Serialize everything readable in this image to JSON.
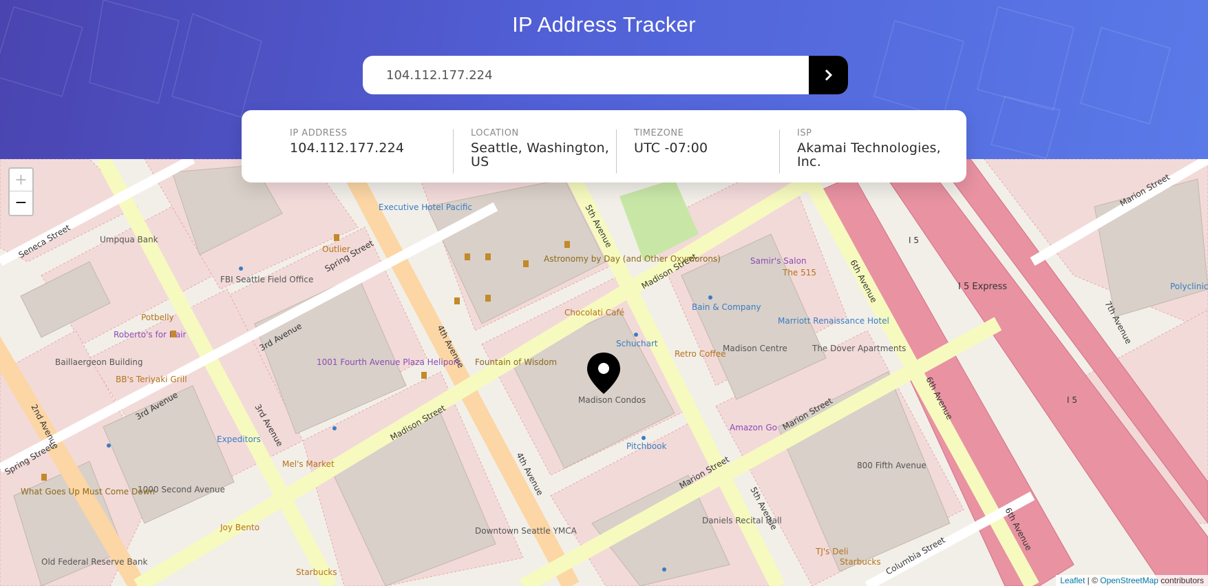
{
  "header": {
    "title": "IP Address Tracker"
  },
  "search": {
    "value": "104.112.177.224",
    "button_icon": "chevron-right-icon"
  },
  "info": {
    "ip_label": "IP ADDRESS",
    "ip_value": "104.112.177.224",
    "location_label": "LOCATION",
    "location_value": "Seattle, Washington, US",
    "timezone_label": "TIMEZONE",
    "timezone_value": "UTC -07:00",
    "isp_label": "ISP",
    "isp_value": "Akamai Technologies, Inc."
  },
  "map": {
    "zoom_in": "+",
    "zoom_out": "−",
    "marker_icon": "location-pin-icon",
    "attribution_leaflet": "Leaflet",
    "attribution_sep": " | © ",
    "attribution_osm": "OpenStreetMap",
    "attribution_suffix": " contributors",
    "labels": {
      "madison_street": "Madison Street",
      "spring_street": "Spring Street",
      "marion_street": "Marion Street",
      "seneca_street": "Seneca Street",
      "columbia_street": "Columbia Street",
      "third_avenue": "3rd Avenue",
      "fourth_avenue": "4th Avenue",
      "fifth_avenue": "5th Avenue",
      "sixth_avenue": "6th Avenue",
      "seventh_avenue": "7th Avenue",
      "second_avenue": "2nd Avenue",
      "i5": "I 5",
      "i5_express": "I 5 Express",
      "baillaergeon": "Baillaergeon Building",
      "fbi": "FBI Seattle Field Office",
      "heliport": "1001 Fourth Avenue Plaza Heliport",
      "madison_condos": "Madison Condos",
      "madison_centre": "Madison Centre",
      "dover": "The Dover Apartments",
      "marriott": "Marriott Renaissance Hotel",
      "downtown_ymca": "Downtown Seattle YMCA",
      "second_avenue_1000": "1000 Second Avenue",
      "daniels": "Daniels Recital Hall",
      "fifth_800": "800 Fifth Avenue",
      "old_federal": "Old Federal Reserve Bank",
      "astronomy": "Astronomy by Day (and Other Oxymorons)",
      "fountain": "Fountain of Wisdom",
      "pitchbook": "Pitchbook",
      "retro": "Retro Coffee",
      "chocolati": "Chocolati Café",
      "starbucks": "Starbucks",
      "expeditors": "Expeditors",
      "amazon_go": "Amazon Go",
      "the515": "The 515",
      "samirs": "Samir's Salon",
      "bain": "Bain & Company",
      "schuchart": "Schuchart",
      "umpqua": "Umpqua Bank",
      "potbelly": "Potbelly",
      "robertos": "Roberto's for Hair",
      "bbs": "BB's Teriyaki Grill",
      "mels": "Mel's Market",
      "joy": "Joy Bento",
      "tjs": "TJ's Deli",
      "what_goes": "What Goes Up Must Come Down",
      "outlier": "Outlier",
      "exec_pacific": "Executive Hotel Pacific",
      "polyclinic": "Polyclinic Parking Garage"
    }
  },
  "colors": {
    "header_start": "#4a44b0",
    "header_end": "#5a7ae8",
    "road_yellow": "#f7fabf",
    "road_orange": "#fcd6a4",
    "motorway": "#e892a2",
    "building": "#d9d0c9",
    "block": "#f2dad9"
  }
}
